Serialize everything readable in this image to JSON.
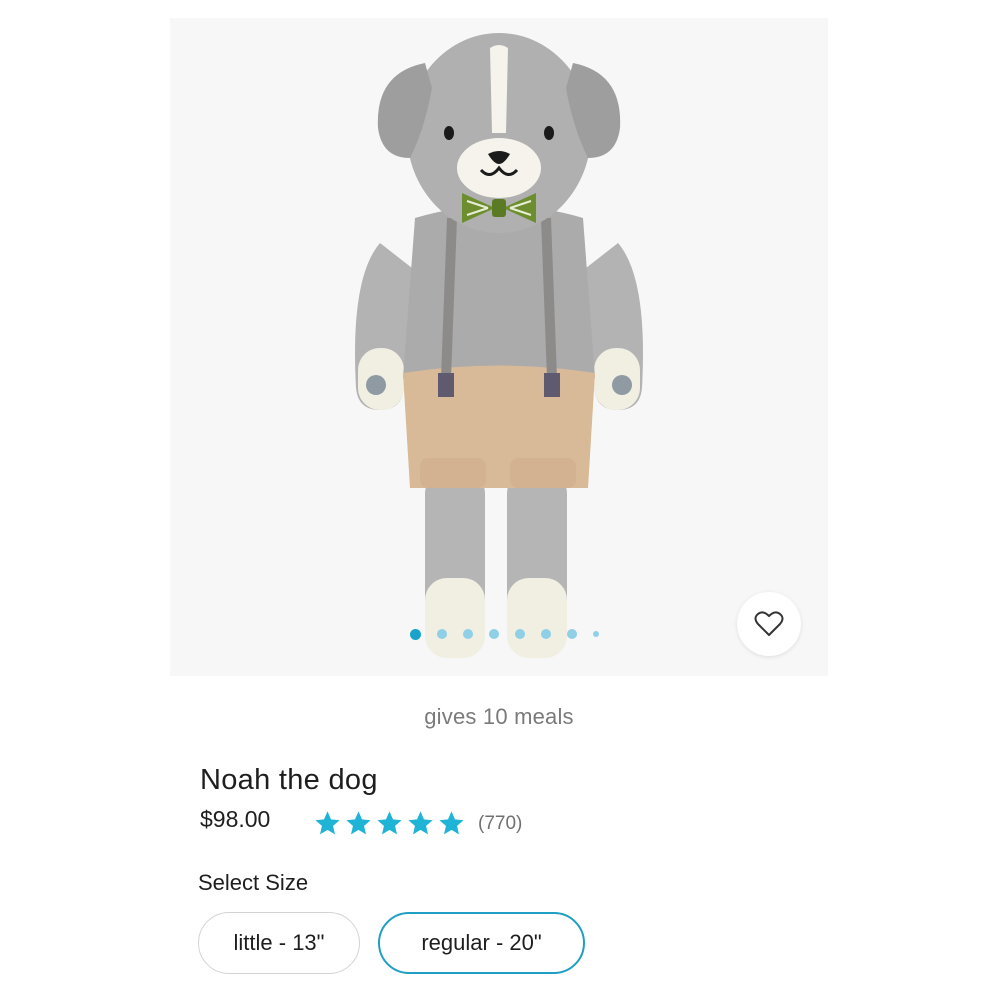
{
  "product": {
    "meals_text": "gives 10 meals",
    "name": "Noah the dog",
    "price": "$98.00",
    "rating": {
      "stars": 5,
      "review_count": "(770)",
      "star_color": "#1fb3d6"
    }
  },
  "gallery": {
    "total_images": 8,
    "active_index": 0,
    "favorite_icon": "heart-outline-icon",
    "accent_color": "#19a3c9"
  },
  "size_selector": {
    "label": "Select Size",
    "options": [
      {
        "label": "little - 13\"",
        "selected": false
      },
      {
        "label": "regular - 20\"",
        "selected": true
      }
    ],
    "selected_border_color": "#1f9fc4"
  }
}
